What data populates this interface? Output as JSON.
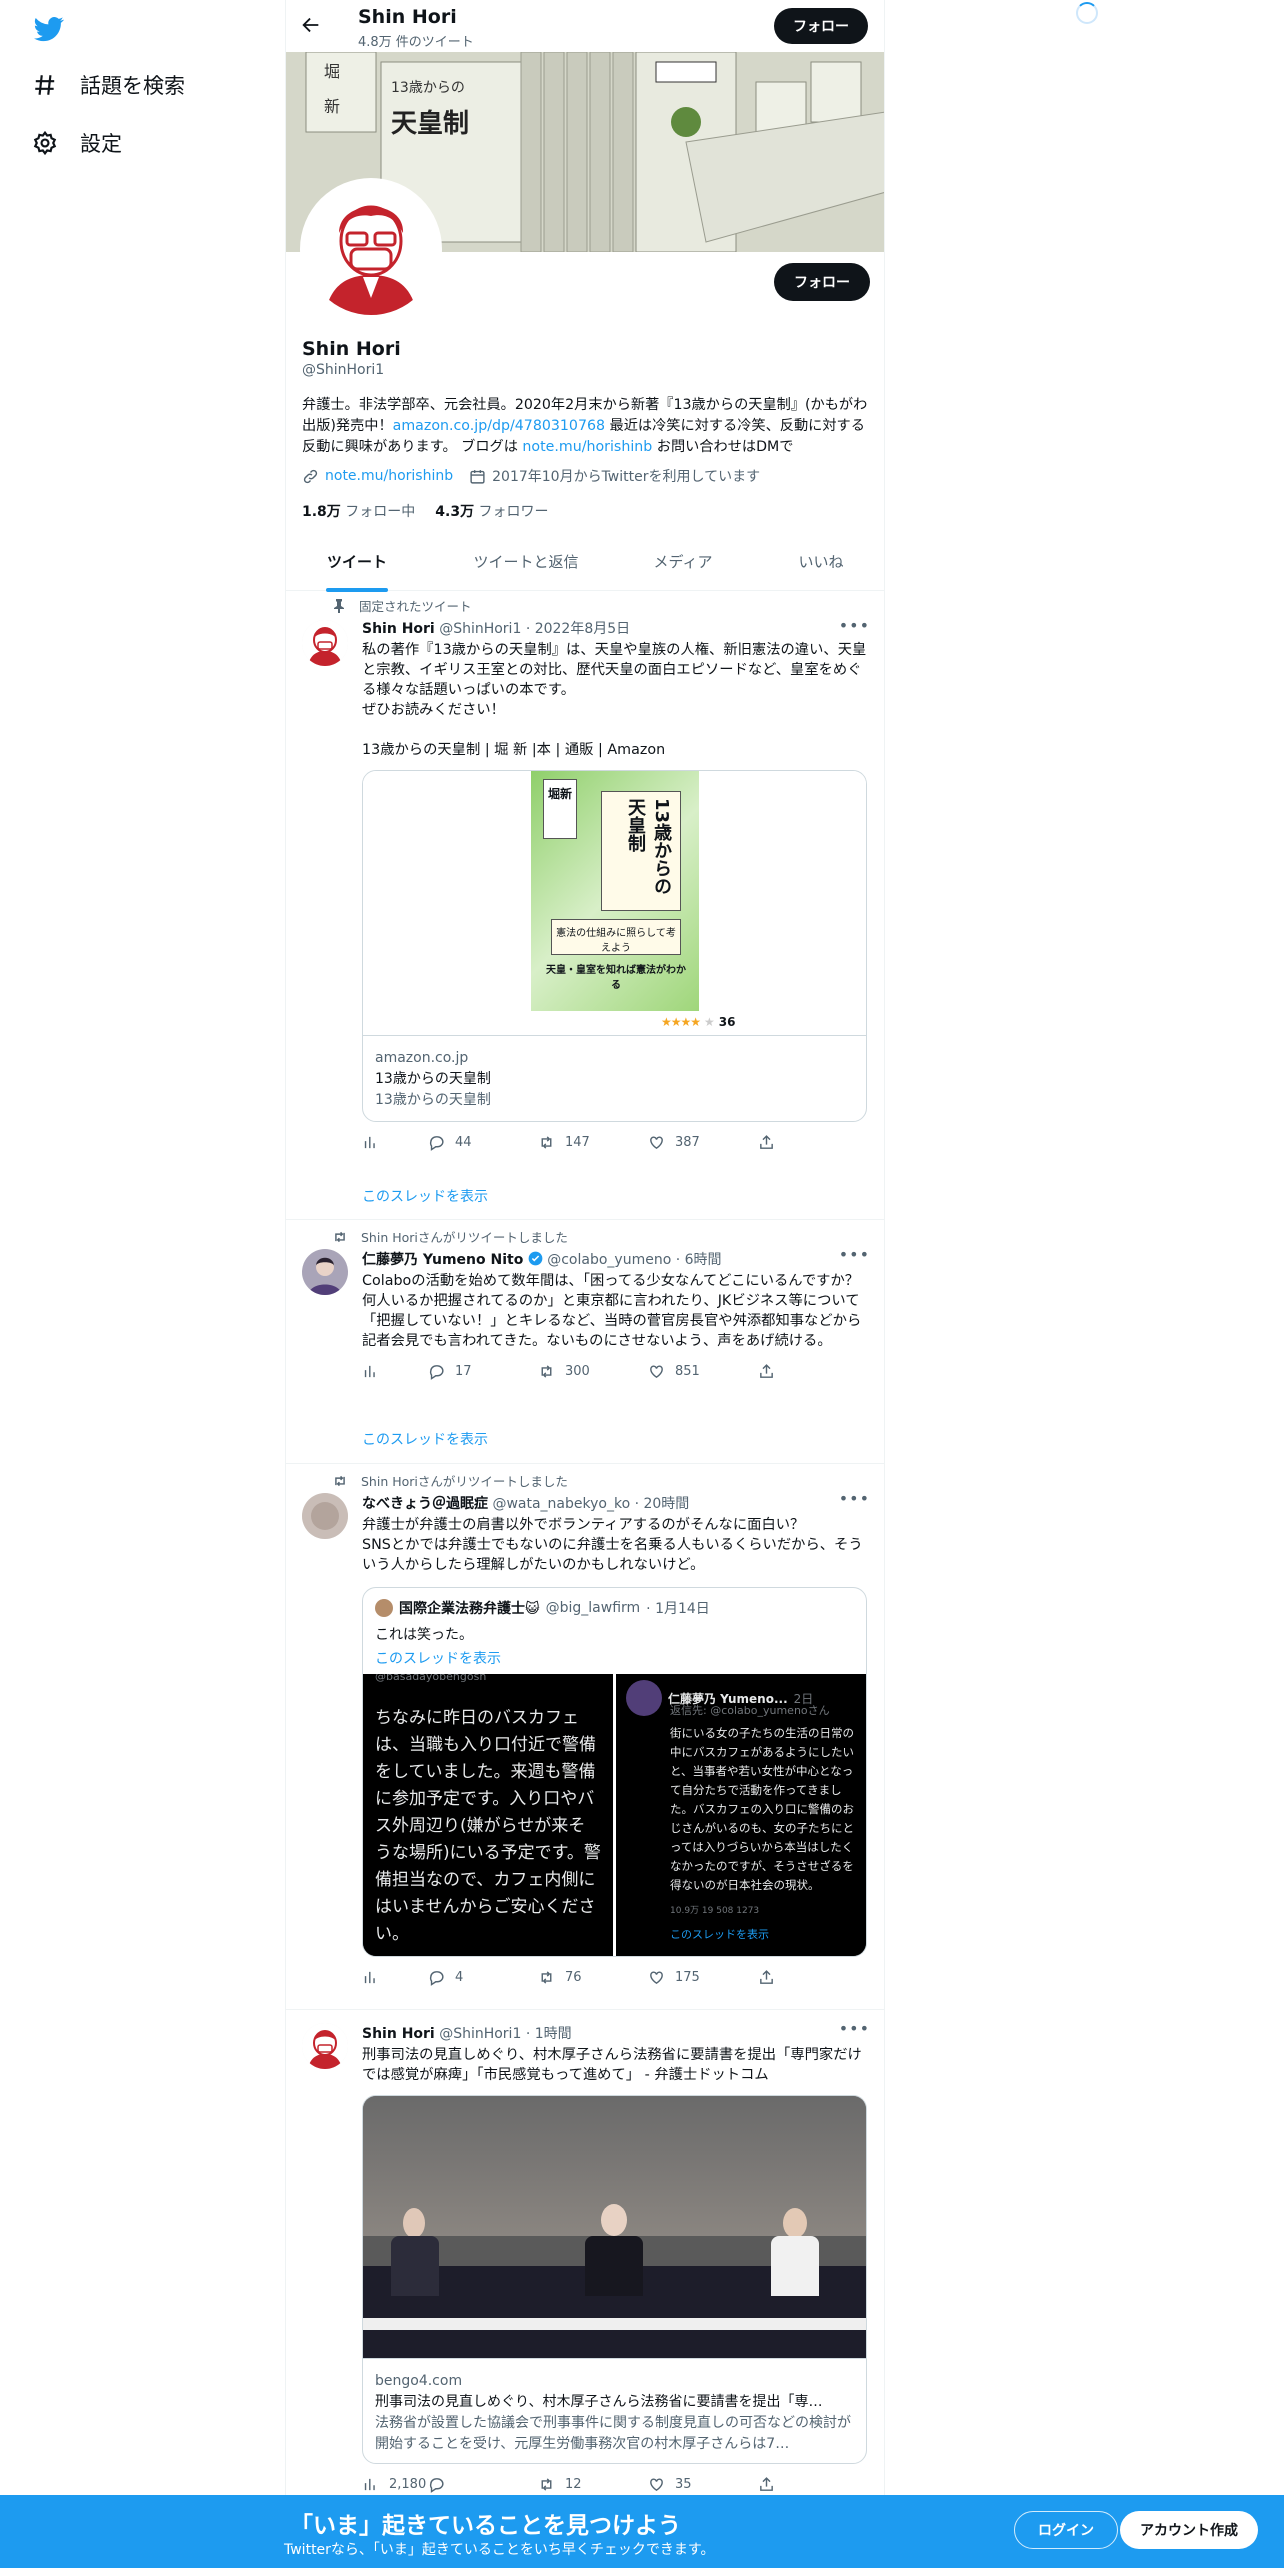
{
  "sidebar": {
    "explore_label": "話題を検索",
    "settings_label": "設定"
  },
  "header": {
    "name": "Shin Hori",
    "tweet_count": "4.8万 件のツイート",
    "follow_label": "フォロー"
  },
  "profile": {
    "follow_label": "フォロー",
    "name": "Shin Hori",
    "handle": "@ShinHori1",
    "bio_1": "弁護士。非法学部卒、元会社員。2020年2月末から新著『13歳からの天皇制』(かもがわ出版)発売中！",
    "bio_link": "amazon.co.jp/dp/4780310768",
    "bio_2": " 最近は冷笑に対する冷笑、反動に対する反動に興味があります。 ブログは ",
    "bio_link2": "note.mu/horishinb",
    "bio_3": " お問い合わせはDMで",
    "website": "note.mu/horishinb",
    "joined": "2017年10月からTwitterを利用しています",
    "following_count": "1.8万",
    "following_label": "フォロー中",
    "followers_count": "4.3万",
    "followers_label": "フォロワー"
  },
  "tabs": [
    "ツイート",
    "ツイートと返信",
    "メディア",
    "いいね"
  ],
  "tweets": [
    {
      "pre": "固定されたツイート",
      "name": "Shin Hori",
      "handle": "@ShinHori1",
      "date": "· 2022年8月5日",
      "text": "私の著作『13歳からの天皇制』は、天皇や皇族の人権、新旧憲法の違い、天皇と宗教、イギリス王室との対比、歴代天皇の面白エピソードなど、皇室をめぐる様々な話題いっぱいの本です。\nぜひお読みください！\n\n13歳からの天皇制 | 堀 新 |本 | 通販 | Amazon",
      "card_domain": "amazon.co.jp",
      "card_title": "13歳からの天皇制",
      "card_desc": "13歳からの天皇制",
      "book_rating": "36",
      "book_title": "13歳からの天皇制",
      "book_author": "堀新",
      "book_sub": "憲法の仕組みに照らして考えよう",
      "book_catch": "天皇・皇室を知れば憲法がわかる",
      "replies": "44",
      "retweets": "147",
      "likes": "387",
      "thread": "このスレッドを表示"
    },
    {
      "pre": "Shin Horiさんがリツイートしました",
      "name": "仁藤夢乃 Yumeno Nito",
      "handle": "@colabo_yumeno",
      "date": "· 6時間",
      "text": "Colaboの活動を始めて数年間は、「困ってる少女なんてどこにいるんですか？何人いるか把握されてるのか」と東京都に言われたり、JKビジネス等について「把握していない！」とキレるなど、当時の菅官房長官や舛添都知事などから記者会見でも言われてきた。ないものにさせないよう、声をあげ続ける。",
      "replies": "17",
      "retweets": "300",
      "likes": "851",
      "thread": "このスレッドを表示"
    },
    {
      "pre": "Shin Horiさんがリツイートしました",
      "name": "なべきょう＠過眠症",
      "handle": "@wata_nabekyo_ko",
      "date": "· 20時間",
      "text": "弁護士が弁護士の肩書以外でボランティアするのがそんなに面白い？\nSNSとかでは弁護士でもないのに弁護士を名乗る人もいるくらいだから、そういう人からしたら理解しがたいのかもしれないけど。",
      "quote_name": "国際企業法務弁護士😺",
      "quote_handle": "@big_lawfirm",
      "quote_date": "· 1月14日",
      "quote_text": "これは笑った。",
      "quote_thread": "このスレッドを表示",
      "img1_handle": "@basadayobengosh",
      "img1_text": "ちなみに昨日のバスカフェは、当職も入り口付近で警備をしていました。来週も警備に参加予定です。入り口やバス外周辺り(嫌がらせが来そうな場所)にいる予定です。警備担当なので、カフェ内側にはいませんからご安心ください。",
      "img2_name": "仁藤夢乃 Yumeno...",
      "img2_date": "2日",
      "img2_reply": "返信先: @colabo_yumenoさん",
      "img2_text": "街にいる女の子たちの生活の日常の中にバスカフェがあるようにしたいと、当事者や若い女性が中心となって自分たちで活動を作ってきました。バスカフェの入り口に警備のおじさんがいるのも、女の子たちにとっては入りづらいから本当はしたくなかったのですが、そうさせざるを得ないのが日本社会の現状。",
      "img2_stats": "10.9万   19   508   1273",
      "img2_thread": "このスレッドを表示",
      "replies": "4",
      "retweets": "76",
      "likes": "175"
    },
    {
      "name": "Shin Hori",
      "handle": "@ShinHori1",
      "date": "· 1時間",
      "text": "刑事司法の見直しめぐり、村木厚子さんら法務省に要請書を提出「専門家だけでは感覚が麻痺」「市民感覚もって進めて」 - 弁護士ドットコム",
      "card_domain": "bengo4.com",
      "card_title": "刑事司法の見直しめぐり、村木厚子さんら法務省に要請書を提出「専…",
      "card_desc": "法務省が設置した協議会で刑事事件に関する制度見直しの可否などの検討が開始することを受け、元厚生労働事務次官の村木厚子さんらは7…",
      "replies": "",
      "retweets": "12",
      "likes": "35",
      "views": "2,180"
    }
  ],
  "bottom_bar": {
    "title": "「いま」起きていることを見つけよう",
    "subtitle": "Twitterなら、「いま」起きていることをいち早くチェックできます。",
    "login_label": "ログイン",
    "signup_label": "アカウント作成"
  },
  "colors": {
    "accent": "#1d9bf0",
    "dark_button": "#0f1419"
  }
}
